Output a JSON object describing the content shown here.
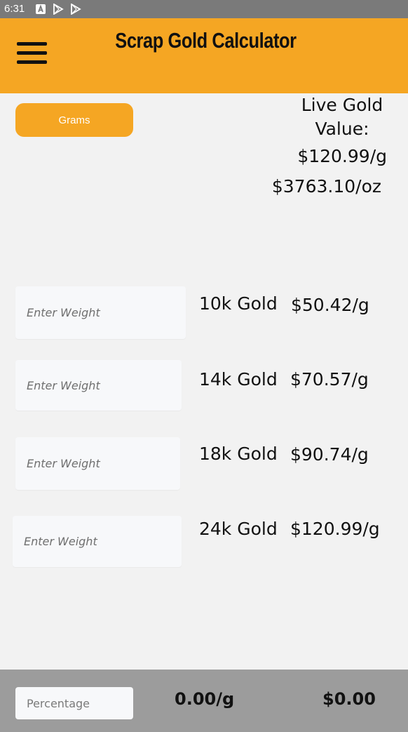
{
  "status_bar": {
    "time": "6:31",
    "icons": [
      "a-notification-icon",
      "play-store-icon",
      "play-icon"
    ]
  },
  "app_bar": {
    "title": "Scrap Gold Calculator",
    "menu_icon": "hamburger-menu-icon",
    "color": "#f5a623"
  },
  "unit_button": {
    "label": "Grams"
  },
  "live_value": {
    "label": "Live Gold Value:",
    "per_gram": "$120.99/g",
    "per_ounce": "$3763.10/oz"
  },
  "rows": [
    {
      "placeholder": "Enter Weight",
      "karat": "10k Gold",
      "price": "$50.42/g"
    },
    {
      "placeholder": "Enter Weight",
      "karat": "14k Gold",
      "price": "$70.57/g"
    },
    {
      "placeholder": "Enter Weight",
      "karat": "18k Gold",
      "price": "$90.74/g"
    },
    {
      "placeholder": "Enter Weight",
      "karat": "24k Gold",
      "price": "$120.99/g"
    }
  ],
  "footer": {
    "percentage_placeholder": "Percentage",
    "total_grams": "0.00/g",
    "total_value": "$0.00"
  }
}
